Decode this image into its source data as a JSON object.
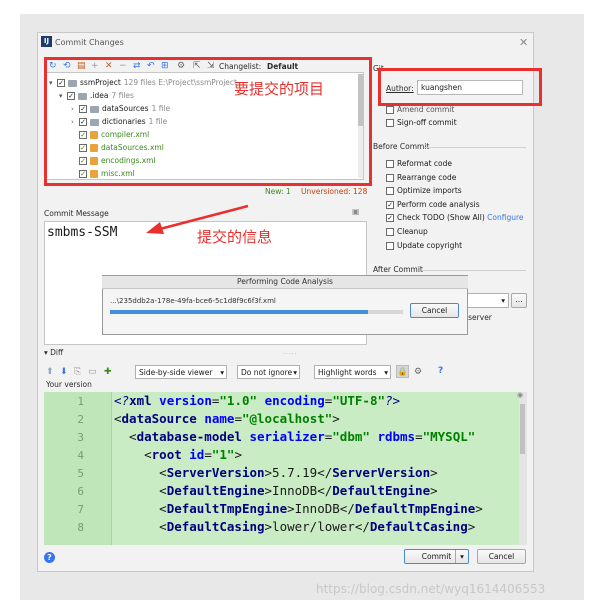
{
  "window": {
    "title": "Commit Changes"
  },
  "toolbar": {
    "changelist_label": "Changelist:",
    "changelist_value": "Default"
  },
  "tree": {
    "rows": [
      {
        "label": "ssmProject",
        "meta": "129 files  E:\\Project\\ssmProject"
      },
      {
        "label": ".idea",
        "meta": "7 files"
      },
      {
        "label": "dataSources",
        "meta": "1 file"
      },
      {
        "label": "dictionaries",
        "meta": "1 file"
      },
      {
        "label": "compiler.xml",
        "meta": ""
      },
      {
        "label": "dataSources.xml",
        "meta": ""
      },
      {
        "label": "encodings.xml",
        "meta": ""
      },
      {
        "label": "misc.xml",
        "meta": ""
      }
    ],
    "status_new": "New: 1",
    "status_unversioned": "Unversioned: 128"
  },
  "git": {
    "section_title": "Git",
    "author_label": "Author:",
    "author_value": "kuangshen",
    "amend_label": "Amend commit",
    "signoff_label": "Sign-off commit"
  },
  "before_commit": {
    "title": "Before Commit",
    "options": [
      {
        "label": "Reformat code",
        "checked": false
      },
      {
        "label": "Rearrange code",
        "checked": false
      },
      {
        "label": "Optimize imports",
        "checked": false
      },
      {
        "label": "Perform code analysis",
        "checked": true
      },
      {
        "label": "Check TODO (Show All)",
        "checked": true,
        "link": "Configure"
      },
      {
        "label": "Cleanup",
        "checked": false
      },
      {
        "label": "Update copyright",
        "checked": false
      }
    ]
  },
  "after_commit": {
    "title": "After Commit",
    "partial_text": "d server"
  },
  "commit_message": {
    "label": "Commit Message",
    "value": "smbms-SSM"
  },
  "annotations": {
    "project_note": "要提交的项目",
    "message_note": "提交的信息"
  },
  "progress_dialog": {
    "title": "Performing Code Analysis",
    "path": "...\\235ddb2a-178e-49fa-bce6-5c1d8f9c6f3f.xml",
    "cancel_label": "Cancel",
    "progress": 0.88
  },
  "diff": {
    "section_label": "Diff",
    "viewer_mode": "Side-by-side viewer",
    "whitespace_mode": "Do not ignore",
    "highlight_mode": "Highlight words",
    "your_version_label": "Your version",
    "line_numbers": [
      "1",
      "2",
      "3",
      "4",
      "5",
      "6",
      "7",
      "8"
    ]
  },
  "footer": {
    "commit_label": "Commit",
    "cancel_label": "Cancel"
  },
  "watermark": "https://blog.csdn.net/wyq1614406553",
  "colors": {
    "accent_red": "#e8312e",
    "diff_green": "#c9ecc4",
    "primary_blue": "#3574f0"
  }
}
